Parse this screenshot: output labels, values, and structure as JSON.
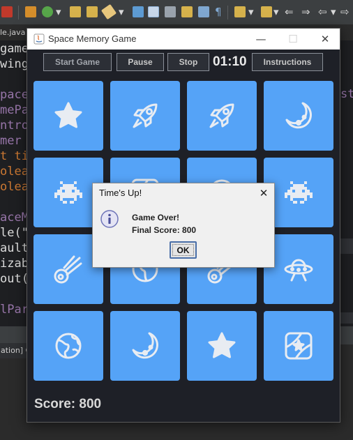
{
  "ide": {
    "editor_tab": "le.java",
    "console_tab": "ation] C",
    "code_lines": [
      {
        "text": "game",
        "color": "#dcdcdc"
      },
      {
        "text": "wing",
        "color": "#dcdcdc"
      },
      {
        "text": "",
        "color": "#dcdcdc"
      },
      {
        "text": "pace",
        "color": "#9876aa"
      },
      {
        "text": "mePa",
        "color": "#9876aa"
      },
      {
        "text": "ntro",
        "color": "#9876aa"
      },
      {
        "text": "mer ",
        "color": "#9876aa"
      },
      {
        "text": "t ti",
        "color": "#cc7832"
      },
      {
        "text": "olea",
        "color": "#cc7832"
      },
      {
        "text": "olea",
        "color": "#cc7832"
      },
      {
        "text": "",
        "color": "#dcdcdc"
      },
      {
        "text": "aceMe",
        "color": "#9876aa"
      },
      {
        "text": "le(\"",
        "color": "#dcdcdc"
      },
      {
        "text": "ault",
        "color": "#dcdcdc"
      },
      {
        "text": "izab",
        "color": "#dcdcdc"
      },
      {
        "text": "out(",
        "color": "#dcdcdc"
      },
      {
        "text": "",
        "color": "#dcdcdc"
      },
      {
        "text": "lPar",
        "color": "#9876aa"
      }
    ],
    "right_fragment": "st"
  },
  "window": {
    "title": "Space Memory Game",
    "minimize_glyph": "—",
    "maximize_glyph": "☐",
    "close_glyph": "✕"
  },
  "controls": {
    "start_label": "Start Game",
    "pause_label": "Pause",
    "stop_label": "Stop",
    "timer": "01:10",
    "instructions_label": "Instructions"
  },
  "cards": [
    {
      "icon": "star"
    },
    {
      "icon": "rocket"
    },
    {
      "icon": "rocket"
    },
    {
      "icon": "moon"
    },
    {
      "icon": "alien"
    },
    {
      "icon": "galaxy"
    },
    {
      "icon": "planet"
    },
    {
      "icon": "alien"
    },
    {
      "icon": "comet"
    },
    {
      "icon": "planet"
    },
    {
      "icon": "comet"
    },
    {
      "icon": "ufo"
    },
    {
      "icon": "earth"
    },
    {
      "icon": "moon"
    },
    {
      "icon": "star"
    },
    {
      "icon": "galaxy"
    }
  ],
  "score": "Score: 800",
  "dialog": {
    "title": "Time's Up!",
    "close_glyph": "✕",
    "line1": "Game Over!",
    "line2": "Final Score: 800",
    "ok_label": "OK"
  },
  "colors": {
    "card": "#55a3f7",
    "icon": "#e8ecf2",
    "window_bg": "#1e2027"
  }
}
